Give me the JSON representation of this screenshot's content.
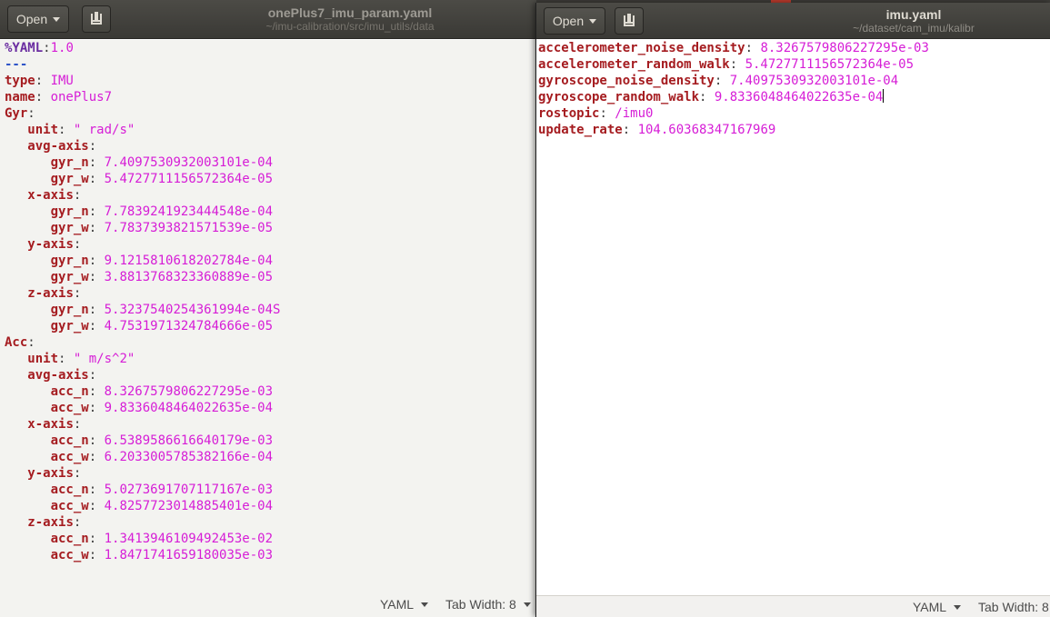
{
  "left_window": {
    "open_label": "Open",
    "title": "onePlus7_imu_param.yaml",
    "path": "~/imu-calibration/src/imu_utils/data",
    "status_language": "YAML",
    "status_tab_width": "Tab Width: 8",
    "lines": [
      {
        "indent": "",
        "key": "%YAML",
        "sep": ":",
        "value": "1.0",
        "style": "directive"
      },
      {
        "indent": "",
        "key": "---",
        "sep": "",
        "value": "",
        "style": "docsep"
      },
      {
        "indent": "",
        "key": "type",
        "sep": ": ",
        "value": "IMU"
      },
      {
        "indent": "",
        "key": "name",
        "sep": ": ",
        "value": "onePlus7"
      },
      {
        "indent": "",
        "key": "Gyr",
        "sep": ":",
        "value": ""
      },
      {
        "indent": "   ",
        "key": "unit",
        "sep": ": ",
        "value": "\" rad/s\""
      },
      {
        "indent": "   ",
        "key": "avg-axis",
        "sep": ":",
        "value": ""
      },
      {
        "indent": "      ",
        "key": "gyr_n",
        "sep": ": ",
        "value": "7.4097530932003101e-04"
      },
      {
        "indent": "      ",
        "key": "gyr_w",
        "sep": ": ",
        "value": "5.4727711156572364e-05"
      },
      {
        "indent": "   ",
        "key": "x-axis",
        "sep": ":",
        "value": ""
      },
      {
        "indent": "      ",
        "key": "gyr_n",
        "sep": ": ",
        "value": "7.7839241923444548e-04"
      },
      {
        "indent": "      ",
        "key": "gyr_w",
        "sep": ": ",
        "value": "7.7837393821571539e-05"
      },
      {
        "indent": "   ",
        "key": "y-axis",
        "sep": ":",
        "value": ""
      },
      {
        "indent": "      ",
        "key": "gyr_n",
        "sep": ": ",
        "value": "9.1215810618202784e-04"
      },
      {
        "indent": "      ",
        "key": "gyr_w",
        "sep": ": ",
        "value": "3.8813768323360889e-05"
      },
      {
        "indent": "   ",
        "key": "z-axis",
        "sep": ":",
        "value": ""
      },
      {
        "indent": "      ",
        "key": "gyr_n",
        "sep": ": ",
        "value": "5.3237540254361994e-04S"
      },
      {
        "indent": "      ",
        "key": "gyr_w",
        "sep": ": ",
        "value": "4.7531971324784666e-05"
      },
      {
        "indent": "",
        "key": "Acc",
        "sep": ":",
        "value": ""
      },
      {
        "indent": "   ",
        "key": "unit",
        "sep": ": ",
        "value": "\" m/s^2\""
      },
      {
        "indent": "   ",
        "key": "avg-axis",
        "sep": ":",
        "value": ""
      },
      {
        "indent": "      ",
        "key": "acc_n",
        "sep": ": ",
        "value": "8.3267579806227295e-03"
      },
      {
        "indent": "      ",
        "key": "acc_w",
        "sep": ": ",
        "value": "9.8336048464022635e-04"
      },
      {
        "indent": "   ",
        "key": "x-axis",
        "sep": ":",
        "value": ""
      },
      {
        "indent": "      ",
        "key": "acc_n",
        "sep": ": ",
        "value": "6.5389586616640179e-03"
      },
      {
        "indent": "      ",
        "key": "acc_w",
        "sep": ": ",
        "value": "6.2033005785382166e-04"
      },
      {
        "indent": "   ",
        "key": "y-axis",
        "sep": ":",
        "value": ""
      },
      {
        "indent": "      ",
        "key": "acc_n",
        "sep": ": ",
        "value": "5.0273691707117167e-03"
      },
      {
        "indent": "      ",
        "key": "acc_w",
        "sep": ": ",
        "value": "4.8257723014885401e-04"
      },
      {
        "indent": "   ",
        "key": "z-axis",
        "sep": ":",
        "value": ""
      },
      {
        "indent": "      ",
        "key": "acc_n",
        "sep": ": ",
        "value": "1.3413946109492453e-02"
      },
      {
        "indent": "      ",
        "key": "acc_w",
        "sep": ": ",
        "value": "1.8471741659180035e-03"
      }
    ]
  },
  "right_window": {
    "open_label": "Open",
    "title": "imu.yaml",
    "path": "~/dataset/cam_imu/kalibr",
    "status_language": "YAML",
    "status_tab_width": "Tab Width: 8",
    "lines": [
      {
        "indent": "",
        "key": "accelerometer_noise_density",
        "sep": ": ",
        "value": "8.3267579806227295e-03"
      },
      {
        "indent": "",
        "key": "accelerometer_random_walk",
        "sep": ": ",
        "value": "5.4727711156572364e-05"
      },
      {
        "indent": "",
        "key": "gyroscope_noise_density",
        "sep": ": ",
        "value": "7.4097530932003101e-04"
      },
      {
        "indent": "",
        "key": "gyroscope_random_walk",
        "sep": ": ",
        "value": "9.8336048464022635e-04",
        "cursor": true
      },
      {
        "indent": "",
        "key": "rostopic",
        "sep": ": ",
        "value": "/imu0"
      },
      {
        "indent": "",
        "key": "update_rate",
        "sep": ": ",
        "value": "104.60368347167969"
      }
    ]
  },
  "colors": {
    "key": "#a51c20",
    "value": "#d61dd6",
    "titlebar": "#3c3b37"
  }
}
